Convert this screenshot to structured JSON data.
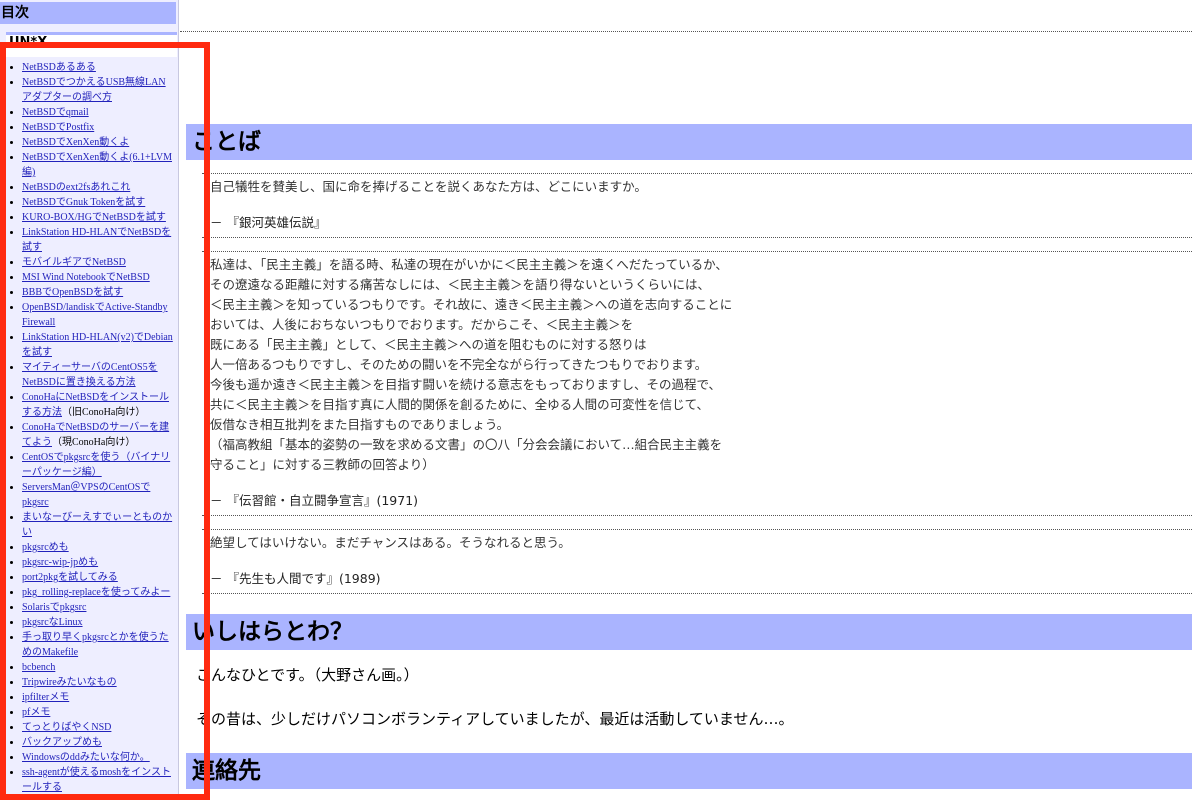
{
  "sidebar": {
    "heading": "目次",
    "section": "UN*X",
    "items": [
      {
        "label": "NetBSDあるある"
      },
      {
        "label": "NetBSDでつかえるUSB無線LANアダプターの調べ方"
      },
      {
        "label": "NetBSDでqmail"
      },
      {
        "label": "NetBSDでPostfix"
      },
      {
        "label": "NetBSDでXenXen動くよ"
      },
      {
        "label": "NetBSDでXenXen動くよ(6.1+LVM編)"
      },
      {
        "label": "NetBSDのext2fsあれこれ"
      },
      {
        "label": "NetBSDでGnuk Tokenを試す"
      },
      {
        "label": "KURO-BOX/HGでNetBSDを試す"
      },
      {
        "label": "LinkStation HD-HLANでNetBSDを試す"
      },
      {
        "label": "モバイルギアでNetBSD"
      },
      {
        "label": "MSI Wind NotebookでNetBSD"
      },
      {
        "label": "BBBでOpenBSDを試す"
      },
      {
        "label": "OpenBSD/landiskでActive-Standby Firewall"
      },
      {
        "label": "LinkStation HD-HLAN(v2)でDebianを試す"
      },
      {
        "label": "マイティーサーバのCentOS5をNetBSDに置き換える方法"
      },
      {
        "label": "ConoHaにNetBSDをインストールする方法",
        "note": "（旧ConoHa向け）"
      },
      {
        "label": "ConoHaでNetBSDのサーバーを建てよう",
        "note": "（現ConoHa向け）"
      },
      {
        "label": "CentOSでpkgsrcを使う（バイナリーパッケージ編）"
      },
      {
        "label": "ServersMan＠VPSのCentOSでpkgsrc"
      },
      {
        "label": "まいなーびーえすでぃーとものかい"
      },
      {
        "label": "pkgsrcめも"
      },
      {
        "label": "pkgsrc-wip-jpめも"
      },
      {
        "label": "port2pkgを試してみる"
      },
      {
        "label": "pkg_rolling-replaceを使ってみよー"
      },
      {
        "label": "Solarisでpkgsrc"
      },
      {
        "label": "pkgsrcなLinux"
      },
      {
        "label": "手っ取り早くpkgsrcとかを使うためのMakefile"
      },
      {
        "label": "bcbench"
      },
      {
        "label": "Tripwireみたいなもの"
      },
      {
        "label": "ipfilterメモ"
      },
      {
        "label": "pfメモ"
      },
      {
        "label": "てっとりばやくNSD"
      },
      {
        "label": "バックアップめも"
      },
      {
        "label": "Windowsのddみたいな何か。"
      },
      {
        "label": "ssh-agentが使えるmoshをインストールする"
      }
    ]
  },
  "main": {
    "section1_title": "ことば",
    "quotes": [
      {
        "lines": [
          "自己犠牲を賛美し、国に命を捧げることを説くあなた方は、どこにいますか。"
        ],
        "source": "－ 『銀河英雄伝説』"
      },
      {
        "lines": [
          "私達は、「民主主義」を語る時、私達の現在がいかに＜民主主義＞を遠くへだたっているか、",
          "その遼遠なる距離に対する痛苦なしには、＜民主主義＞を語り得ないというくらいには、",
          "＜民主主義＞を知っているつもりです。それ故に、遠き＜民主主義＞への道を志向することに",
          "おいては、人後におちないつもりでおります。だからこそ、＜民主主義＞を",
          "既にある「民主主義」として、＜民主主義＞への道を阻むものに対する怒りは",
          "人一倍あるつもりですし、そのための闘いを不完全ながら行ってきたつもりでおります。",
          "今後も遥か遠き＜民主主義＞を目指す闘いを続ける意志をもっておりますし、その過程で、",
          "共に＜民主主義＞を目指す真に人間的関係を創るために、全ゆる人間の可変性を信じて、",
          "仮借なき相互批判をまた目指すものでありましょう。",
          "（福高教組「基本的姿勢の一致を求める文書」の〇八「分会会議において…組合民主主義を",
          "守ること」に対する三教師の回答より）"
        ],
        "source": "－ 『伝習館・自立闘争宣言』(1971)"
      },
      {
        "lines": [
          "絶望してはいけない。まだチャンスはある。そうなれると思う。"
        ],
        "source": "－ 『先生も人間です』(1989)"
      }
    ],
    "section2_title": "いしはらとわ？",
    "para1": "こんなひとです。（大野さん画。）",
    "para2": "その昔は、少しだけパソコンボランティアしていましたが、最近は活動していません…。",
    "section3_title": "連絡先"
  },
  "colors": {
    "heading_bg": "#aab4ff",
    "sidebar_bg": "#eeeeff",
    "link": "#2222bb",
    "highlight_frame": "#ff2a10"
  }
}
